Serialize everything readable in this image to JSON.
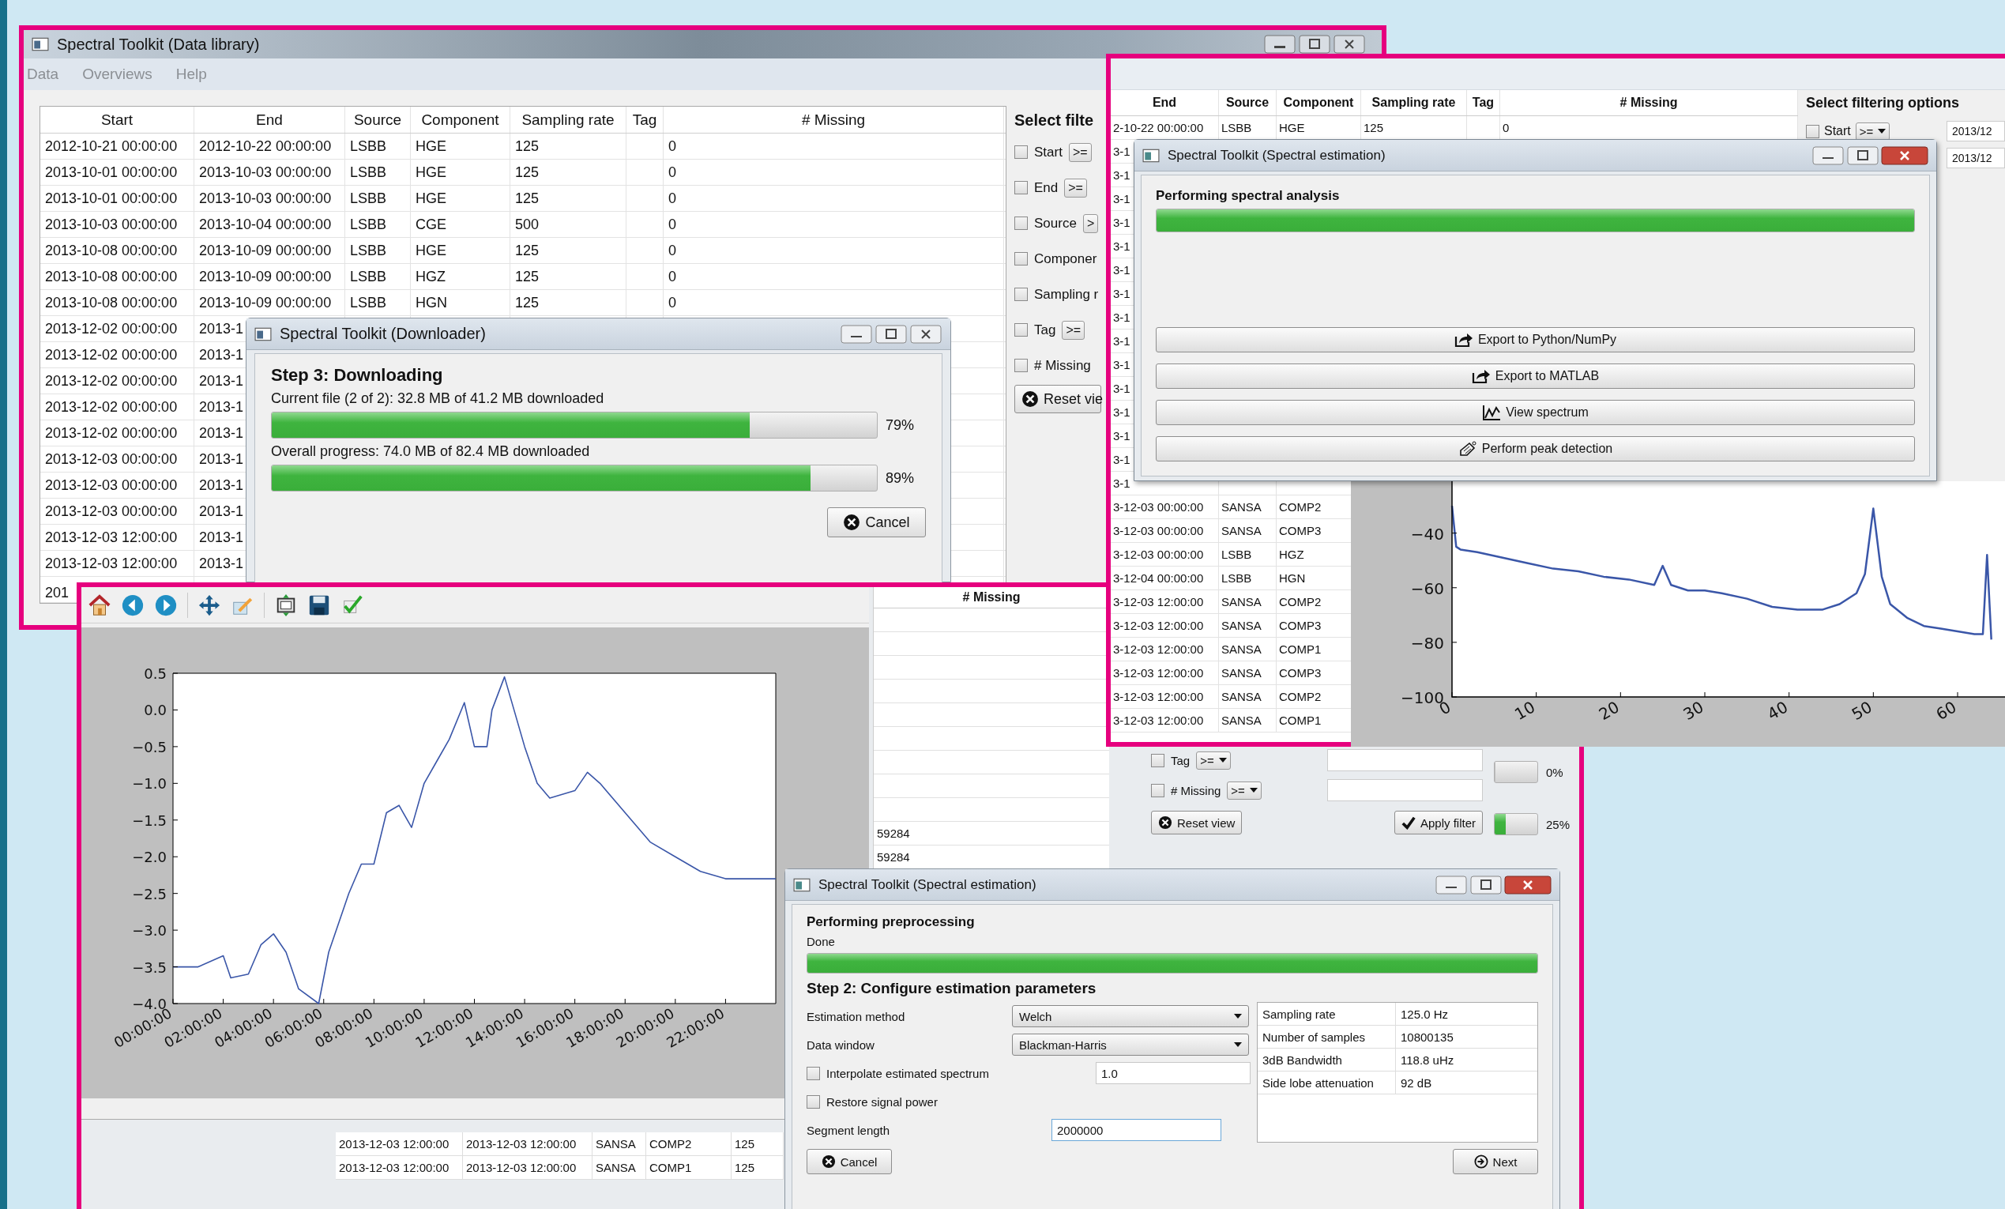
{
  "data_library": {
    "title": "Spectral Toolkit (Data library)",
    "menu": [
      "Data",
      "Overviews",
      "Help"
    ],
    "table": {
      "columns": [
        "Start",
        "End",
        "Source",
        "Component",
        "Sampling rate",
        "Tag",
        "# Missing"
      ],
      "rows": [
        {
          "start": "2012-10-21 00:00:00",
          "end": "2012-10-22 00:00:00",
          "source": "LSBB",
          "component": "HGE",
          "sampling_rate": "125",
          "missing": "0"
        },
        {
          "start": "2013-10-01 00:00:00",
          "end": "2013-10-03 00:00:00",
          "source": "LSBB",
          "component": "HGE",
          "sampling_rate": "125",
          "missing": "0"
        },
        {
          "start": "2013-10-01 00:00:00",
          "end": "2013-10-03 00:00:00",
          "source": "LSBB",
          "component": "HGE",
          "sampling_rate": "125",
          "missing": "0"
        },
        {
          "start": "2013-10-03 00:00:00",
          "end": "2013-10-04 00:00:00",
          "source": "LSBB",
          "component": "CGE",
          "sampling_rate": "500",
          "missing": "0"
        },
        {
          "start": "2013-10-08 00:00:00",
          "end": "2013-10-09 00:00:00",
          "source": "LSBB",
          "component": "HGE",
          "sampling_rate": "125",
          "missing": "0"
        },
        {
          "start": "2013-10-08 00:00:00",
          "end": "2013-10-09 00:00:00",
          "source": "LSBB",
          "component": "HGZ",
          "sampling_rate": "125",
          "missing": "0"
        },
        {
          "start": "2013-10-08 00:00:00",
          "end": "2013-10-09 00:00:00",
          "source": "LSBB",
          "component": "HGN",
          "sampling_rate": "125",
          "missing": "0"
        },
        {
          "start": "2013-12-02 00:00:00",
          "end": "2013-1"
        },
        {
          "start": "2013-12-02 00:00:00",
          "end": "2013-1"
        },
        {
          "start": "2013-12-02 00:00:00",
          "end": "2013-1"
        },
        {
          "start": "2013-12-02 00:00:00",
          "end": "2013-1"
        },
        {
          "start": "2013-12-02 00:00:00",
          "end": "2013-1"
        },
        {
          "start": "2013-12-03 00:00:00",
          "end": "2013-1"
        },
        {
          "start": "2013-12-03 00:00:00",
          "end": "2013-1"
        },
        {
          "start": "2013-12-03 00:00:00",
          "end": "2013-1"
        },
        {
          "start": "2013-12-03 12:00:00",
          "end": "2013-1"
        },
        {
          "start": "2013-12-03 12:00:00",
          "end": "2013-1"
        },
        {
          "start": "201"
        }
      ]
    },
    "filter": {
      "title": "Select filte",
      "rows": [
        {
          "label": "Start",
          "checked": false,
          "op": ">="
        },
        {
          "label": "End",
          "checked": false,
          "op": ">="
        },
        {
          "label": "Source",
          "checked": false,
          "op": ">"
        },
        {
          "label": "Componer",
          "checked": false
        },
        {
          "label": "Sampling r",
          "checked": false
        },
        {
          "label": "Tag",
          "checked": false,
          "op": ">="
        },
        {
          "label": "# Missing",
          "checked": false
        }
      ],
      "reset_button": "Reset vie"
    }
  },
  "downloader": {
    "title": "Spectral Toolkit (Downloader)",
    "heading": "Step 3: Downloading",
    "progress": [
      {
        "caption": "Current file (2 of 2): 32.8 MB of 41.2 MB downloaded",
        "level": 0.79,
        "reading": "79%"
      },
      {
        "caption": "Overall progress: 74.0 MB of 82.4 MB downloaded",
        "level": 0.89,
        "reading": "89%"
      }
    ],
    "cancel_button": "Cancel"
  },
  "spectral_window": {
    "table": {
      "columns": [
        "End",
        "Source",
        "Component",
        "Sampling rate",
        "Tag",
        "# Missing"
      ],
      "rows": [
        {
          "end": "2-10-22 00:00:00",
          "source": "LSBB",
          "component": "HGE",
          "sampling_rate": "125",
          "missing": "0"
        },
        {
          "end": "3-1"
        },
        {
          "end": "3-1"
        },
        {
          "end": "3-1"
        },
        {
          "end": "3-1"
        },
        {
          "end": "3-1"
        },
        {
          "end": "3-1"
        },
        {
          "end": "3-1"
        },
        {
          "end": "3-1"
        },
        {
          "end": "3-1"
        },
        {
          "end": "3-1"
        },
        {
          "end": "3-1"
        },
        {
          "end": "3-1"
        },
        {
          "end": "3-1"
        },
        {
          "end": "3-1"
        },
        {
          "end": "3-1"
        },
        {
          "end": "3-12-03 00:00:00",
          "source": "SANSA",
          "component": "COMP2"
        },
        {
          "end": "3-12-03 00:00:00",
          "source": "SANSA",
          "component": "COMP3"
        },
        {
          "end": "3-12-03 00:00:00",
          "source": "LSBB",
          "component": "HGZ"
        },
        {
          "end": "3-12-04 00:00:00",
          "source": "LSBB",
          "component": "HGN"
        },
        {
          "end": "3-12-03 12:00:00",
          "source": "SANSA",
          "component": "COMP2"
        },
        {
          "end": "3-12-03 12:00:00",
          "source": "SANSA",
          "component": "COMP3"
        },
        {
          "end": "3-12-03 12:00:00",
          "source": "SANSA",
          "component": "COMP1"
        },
        {
          "end": "3-12-03 12:00:00",
          "source": "SANSA",
          "component": "COMP3"
        },
        {
          "end": "3-12-03 12:00:00",
          "source": "SANSA",
          "component": "COMP2"
        },
        {
          "end": "3-12-03 12:00:00",
          "source": "SANSA",
          "component": "COMP1"
        }
      ]
    },
    "filter": {
      "title": "Select filtering options",
      "start_label": "Start",
      "start_checked": false,
      "start_op": ">=",
      "start_value": "2013/12",
      "end_value": "2013/12"
    },
    "dialog": {
      "title": "Spectral Toolkit (Spectral estimation)",
      "heading": "Performing spectral analysis",
      "level": 1,
      "buttons": [
        "Export to Python/NumPy",
        "Export to MATLAB",
        "View spectrum",
        "Perform peak detection"
      ]
    },
    "chart_data": {
      "type": "line",
      "x": [
        0,
        0.5,
        1,
        3,
        6,
        9,
        12,
        15,
        18,
        21,
        24,
        25,
        26,
        28,
        30,
        32,
        35,
        38,
        41,
        44,
        46,
        48,
        49,
        50,
        51,
        52,
        54,
        56,
        58,
        60,
        62,
        63,
        63.5,
        64
      ],
      "series": [
        {
          "color": "#3a56a8",
          "values": [
            -30,
            -45,
            -46,
            -47,
            -49,
            -51,
            -53,
            -54,
            -56,
            -57,
            -59,
            -52,
            -59,
            -61,
            -61,
            -62,
            -64,
            -67,
            -68,
            -68,
            -66,
            -62,
            -55,
            -31,
            -56,
            -66,
            -71,
            -74,
            -75,
            -76,
            -77,
            -77,
            -48,
            -79
          ]
        }
      ],
      "xlim": [
        0,
        66
      ],
      "ylim": [
        -100,
        -21
      ],
      "xticks": [
        {
          "value": 0,
          "label": "0"
        },
        {
          "value": 10,
          "label": "10"
        },
        {
          "value": 20,
          "label": "20"
        },
        {
          "value": 30,
          "label": "30"
        },
        {
          "value": 40,
          "label": "40"
        },
        {
          "value": 50,
          "label": "50"
        },
        {
          "value": 60,
          "label": "60"
        }
      ],
      "yticks": [
        {
          "value": -100,
          "label": "−100"
        },
        {
          "value": -80,
          "label": "−80"
        },
        {
          "value": -60,
          "label": "−60"
        },
        {
          "value": -40,
          "label": "−40"
        }
      ]
    }
  },
  "plot_window": {
    "chart_data": {
      "type": "line",
      "x": [
        0,
        1,
        2,
        2.3,
        3,
        3.5,
        4,
        4.5,
        5,
        5.8,
        6.2,
        7,
        7.5,
        8,
        8.5,
        9,
        9.5,
        10,
        10.5,
        11,
        11.6,
        12,
        12.5,
        12.7,
        13.2,
        14,
        14.5,
        15,
        16,
        16.5,
        17,
        18,
        19,
        20,
        21,
        22,
        23,
        24
      ],
      "series": [
        {
          "color": "#3a56a8",
          "values": [
            -3.5,
            -3.5,
            -3.35,
            -3.65,
            -3.6,
            -3.2,
            -3.05,
            -3.3,
            -3.8,
            -4.0,
            -3.3,
            -2.5,
            -2.1,
            -2.1,
            -1.4,
            -1.3,
            -1.6,
            -1.0,
            -0.7,
            -0.4,
            0.1,
            -0.5,
            -0.5,
            0.0,
            0.45,
            -0.5,
            -1.0,
            -1.2,
            -1.1,
            -0.85,
            -1.0,
            -1.4,
            -1.8,
            -2.0,
            -2.2,
            -2.3,
            -2.3,
            -2.3
          ]
        }
      ],
      "xlim": [
        0,
        24
      ],
      "ylim": [
        -4,
        0.5
      ],
      "xticks": [
        {
          "value": 0,
          "label": "00:00:00"
        },
        {
          "value": 2,
          "label": "02:00:00"
        },
        {
          "value": 4,
          "label": "04:00:00"
        },
        {
          "value": 6,
          "label": "06:00:00"
        },
        {
          "value": 8,
          "label": "08:00:00"
        },
        {
          "value": 10,
          "label": "10:00:00"
        },
        {
          "value": 12,
          "label": "12:00:00"
        },
        {
          "value": 14,
          "label": "14:00:00"
        },
        {
          "value": 16,
          "label": "16:00:00"
        },
        {
          "value": 18,
          "label": "18:00:00"
        },
        {
          "value": 20,
          "label": "20:00:00"
        },
        {
          "value": 22,
          "label": "22:00:00"
        }
      ],
      "yticks": [
        {
          "value": 0.5,
          "label": "0.5"
        },
        {
          "value": 0,
          "label": "0.0"
        },
        {
          "value": -0.5,
          "label": "−0.5"
        },
        {
          "value": -1,
          "label": "−1.0"
        },
        {
          "value": -1.5,
          "label": "−1.5"
        },
        {
          "value": -2,
          "label": "−2.0"
        },
        {
          "value": -2.5,
          "label": "−2.5"
        },
        {
          "value": -3,
          "label": "−3.0"
        },
        {
          "value": -3.5,
          "label": "−3.5"
        },
        {
          "value": -4,
          "label": "−4.0"
        }
      ]
    }
  },
  "background_library": {
    "missing_header": "# Missing",
    "missing_values": [
      "59284",
      "59284"
    ],
    "filter_rows": [
      {
        "label": "Tag",
        "checked": false,
        "op": ">="
      },
      {
        "label": "# Missing",
        "checked": false,
        "op": ">="
      }
    ],
    "reset_button": "Reset view",
    "apply_button": "Apply filter",
    "progress": [
      {
        "level": 0,
        "reading": "0%"
      },
      {
        "level": 0.25,
        "reading": "25%"
      }
    ],
    "rows": [
      [
        "2013-12-03 12:00:00",
        "2013-12-03 12:00:00",
        "SANSA",
        "COMP2",
        "125"
      ],
      [
        "2013-12-03 12:00:00",
        "2013-12-03 12:00:00",
        "SANSA",
        "COMP1",
        "125"
      ]
    ]
  },
  "estimation_window": {
    "title": "Spectral Toolkit (Spectral estimation)",
    "preprocessing_heading": "Performing preprocessing",
    "preprocessing_status": "Done",
    "level": 1,
    "step_heading": "Step 2: Configure estimation parameters",
    "fields": [
      {
        "kind": "select",
        "label": "Estimation method",
        "value": "Welch"
      },
      {
        "kind": "select",
        "label": "Data window",
        "value": "Blackman-Harris"
      },
      {
        "kind": "checkbox_input",
        "label": "Interpolate estimated spectrum",
        "checked": false,
        "value": "1.0"
      },
      {
        "kind": "checkbox",
        "label": "Restore signal power",
        "checked": false
      },
      {
        "kind": "input",
        "label": "Segment length",
        "value": "2000000"
      }
    ],
    "info": [
      {
        "name": "Sampling rate",
        "value": "125.0 Hz"
      },
      {
        "name": "Number of samples",
        "value": "10800135"
      },
      {
        "name": "3dB Bandwidth",
        "value": "118.8 uHz"
      },
      {
        "name": "Side lobe attenuation",
        "value": "92 dB"
      }
    ],
    "cancel_button": "Cancel",
    "next_button": "Next"
  }
}
